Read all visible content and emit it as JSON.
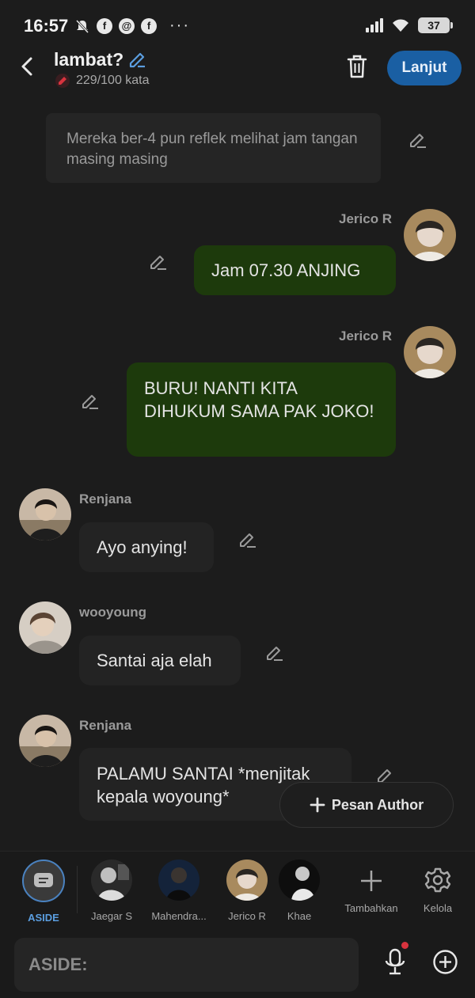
{
  "status_bar": {
    "time": "16:57",
    "battery": "37",
    "dots": "···"
  },
  "header": {
    "title": "lambat?",
    "word_count": "229/100 kata",
    "next_label": "Lanjut"
  },
  "messages": [
    {
      "kind": "narration",
      "text": "Mereka ber-4 pun reflek melihat jam tangan masing masing"
    },
    {
      "kind": "right",
      "sender": "Jerico R",
      "text": "Jam 07.30 ANJING"
    },
    {
      "kind": "right",
      "sender": "Jerico R",
      "text": "BURU! NANTI KITA DIHUKUM SAMA PAK JOKO!"
    },
    {
      "kind": "left",
      "sender": "Renjana",
      "text": "Ayo anying!"
    },
    {
      "kind": "left",
      "sender": "wooyoung",
      "text": "Santai aja elah"
    },
    {
      "kind": "left",
      "sender": "Renjana",
      "text": "PALAMU SANTAI *menjitak kepala woyoung*"
    }
  ],
  "fab": {
    "label": "Pesan Author"
  },
  "characters": [
    {
      "label": "ASIDE",
      "active": true
    },
    {
      "label": "Jaegar S"
    },
    {
      "label": "Mahendra..."
    },
    {
      "label": "Jerico R"
    },
    {
      "label": "Khae"
    },
    {
      "label": "Tambahkan"
    },
    {
      "label": "Kelola"
    }
  ],
  "input": {
    "prefix": "ASIDE:"
  },
  "colors": {
    "accent": "#1a5fa3",
    "right_bubble": "#1d3a0c",
    "left_bubble": "#232323",
    "background": "#1c1c1c"
  }
}
